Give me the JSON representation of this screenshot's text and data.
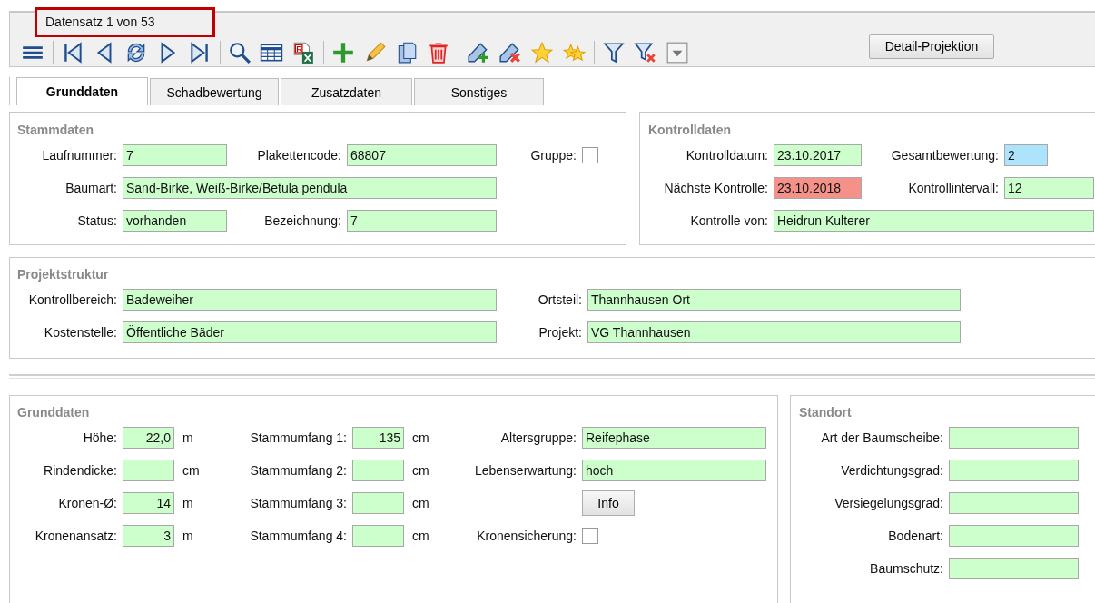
{
  "record_counter": "Datensatz 1 von 53",
  "detail_button": "Detail-Projektion",
  "tabs": [
    {
      "label": "Grunddaten",
      "selected": true
    },
    {
      "label": "Schadbewertung",
      "selected": false
    },
    {
      "label": "Zusatzdaten",
      "selected": false
    },
    {
      "label": "Sonstiges",
      "selected": false
    }
  ],
  "stammdaten": {
    "title": "Stammdaten",
    "rows": [
      [
        {
          "label": "Laufnummer:",
          "value": "7",
          "kind": "text",
          "color": "#ccffcc"
        },
        {
          "label": "Plakettencode:",
          "value": "68807",
          "kind": "text",
          "color": "#ccffcc"
        },
        {
          "label": "Gruppe:",
          "kind": "checkbox",
          "checked": false
        }
      ],
      [
        {
          "label": "Baumart:",
          "value": "Sand-Birke, Weiß-Birke/Betula pendula",
          "kind": "wide",
          "color": "#ccffcc"
        }
      ],
      [
        {
          "label": "Status:",
          "value": "vorhanden",
          "kind": "text",
          "color": "#ccffcc"
        },
        {
          "label": "Bezeichnung:",
          "value": "7",
          "kind": "text",
          "color": "#ccffcc"
        }
      ]
    ]
  },
  "kontrolldaten": {
    "title": "Kontrolldaten",
    "rows": [
      [
        {
          "label": "Kontrolldatum:",
          "value": "23.10.2017",
          "kind": "text",
          "color": "#ccffcc"
        },
        {
          "label": "Gesamtbewertung:",
          "value": "2",
          "kind": "narrow",
          "color": "#aee4fb"
        }
      ],
      [
        {
          "label": "Nächste Kontrolle:",
          "value": "23.10.2018",
          "kind": "text",
          "color": "#f4928a"
        },
        {
          "label": "Kontrollintervall:",
          "value": "12",
          "kind": "text",
          "color": "#ccffcc"
        }
      ],
      [
        {
          "label": "Kontrolle von:",
          "value": "Heidrun Kulterer",
          "kind": "wide",
          "color": "#ccffcc"
        }
      ]
    ]
  },
  "projektstruktur": {
    "title": "Projektstruktur",
    "rows": [
      [
        {
          "label": "Kontrollbereich:",
          "value": "Badeweiher",
          "kind": "text",
          "color": "#ccffcc"
        },
        {
          "label": "Ortsteil:",
          "value": "Thannhausen Ort",
          "kind": "text",
          "color": "#ccffcc"
        }
      ],
      [
        {
          "label": "Kostenstelle:",
          "value": "Öffentliche Bäder",
          "kind": "text",
          "color": "#ccffcc"
        },
        {
          "label": "Projekt:",
          "value": "VG Thannhausen",
          "kind": "text",
          "color": "#ccffcc"
        }
      ]
    ]
  },
  "grunddaten": {
    "title": "Grunddaten",
    "rows": [
      [
        {
          "label": "Höhe:",
          "value": "22,0",
          "unit": "m",
          "kind": "number",
          "color": "#ccffcc"
        },
        {
          "label": "Stammumfang 1:",
          "value": "135",
          "unit": "cm",
          "kind": "number",
          "color": "#ccffcc"
        },
        {
          "label": "Altersgruppe:",
          "value": "Reifephase",
          "kind": "text",
          "color": "#ccffcc"
        }
      ],
      [
        {
          "label": "Rindendicke:",
          "unit": "cm",
          "kind": "number",
          "color": "#ccffcc"
        },
        {
          "label": "Stammumfang 2:",
          "unit": "cm",
          "kind": "number",
          "color": "#ccffcc"
        },
        {
          "label": "Lebenserwartung:",
          "value": "hoch",
          "kind": "text",
          "color": "#ccffcc"
        }
      ],
      [
        {
          "label": "Kronen-Ø:",
          "value": "14",
          "unit": "m",
          "kind": "number",
          "color": "#ccffcc"
        },
        {
          "label": "Stammumfang 3:",
          "unit": "cm",
          "kind": "number",
          "color": "#ccffcc"
        },
        {
          "value": "Info",
          "kind": "button"
        }
      ],
      [
        {
          "label": "Kronenansatz:",
          "value": "3",
          "unit": "m",
          "kind": "number",
          "color": "#ccffcc"
        },
        {
          "label": "Stammumfang 4:",
          "unit": "cm",
          "kind": "number",
          "color": "#ccffcc"
        },
        {
          "label": "Kronensicherung:",
          "kind": "checkbox",
          "checked": false
        }
      ]
    ]
  },
  "standort": {
    "title": "Standort",
    "rows": [
      [
        {
          "label": "Art der Baumscheibe:",
          "kind": "text",
          "color": "#ccffcc"
        }
      ],
      [
        {
          "label": "Verdichtungsgrad:",
          "kind": "text",
          "color": "#ccffcc"
        }
      ],
      [
        {
          "label": "Versiegelungsgrad:",
          "kind": "text",
          "color": "#ccffcc"
        }
      ],
      [
        {
          "label": "Bodenart:",
          "kind": "text",
          "color": "#ccffcc"
        }
      ],
      [
        {
          "label": "Baumschutz:",
          "kind": "text",
          "color": "#ccffcc"
        }
      ]
    ]
  }
}
